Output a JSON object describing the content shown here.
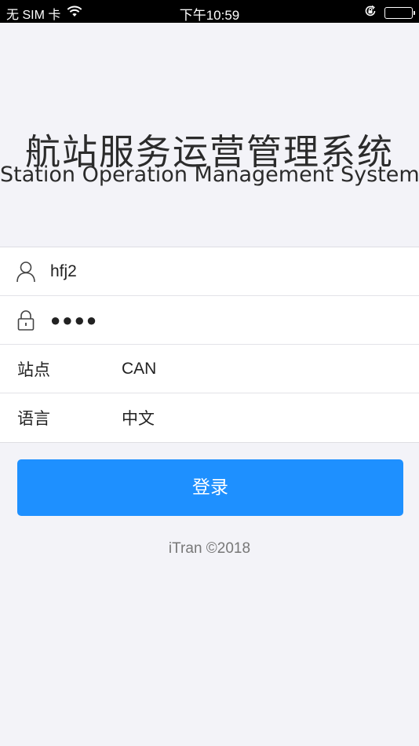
{
  "status_bar": {
    "carrier": "无 SIM 卡",
    "time": "下午10:59",
    "icons": [
      "wifi-icon",
      "orientation-lock-icon",
      "battery-icon"
    ]
  },
  "header": {
    "title_cn": "航站服务运营管理系统",
    "title_en": "Station Operation Management System"
  },
  "form": {
    "username": {
      "icon": "user-icon",
      "value": "hfj2"
    },
    "password": {
      "icon": "lock-icon",
      "value": "●●●●"
    },
    "station": {
      "label": "站点",
      "value": "CAN"
    },
    "language": {
      "label": "语言",
      "value": "中文"
    }
  },
  "login_button": {
    "label": "登录"
  },
  "footer": {
    "text": "iTran ©2018"
  },
  "colors": {
    "accent": "#1e90ff",
    "background": "#f3f3f8",
    "card": "#ffffff",
    "footer_text": "#777777"
  }
}
